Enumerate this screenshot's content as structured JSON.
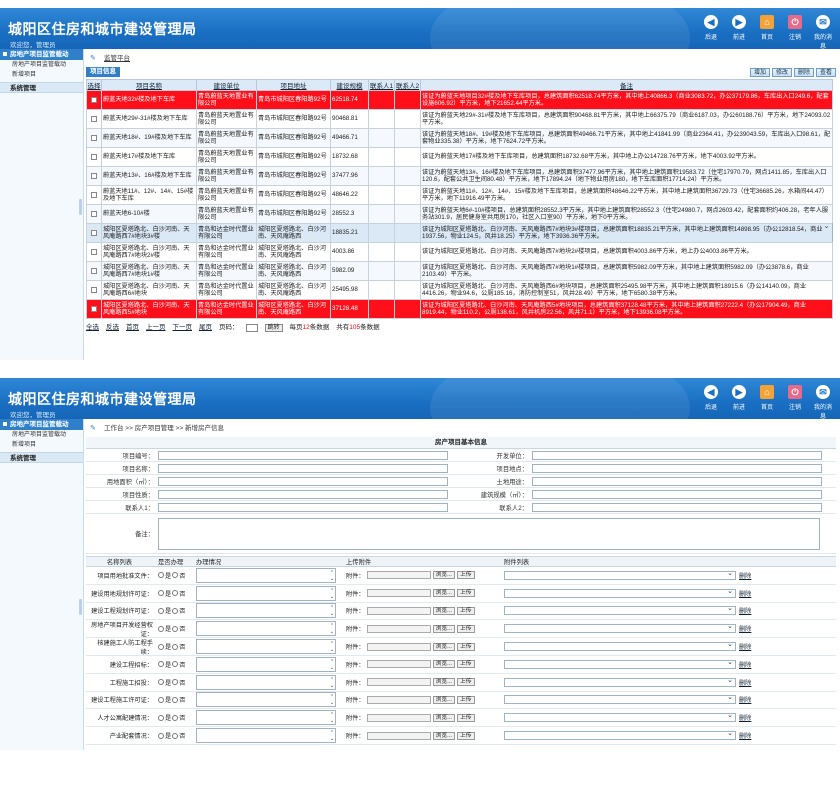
{
  "header": {
    "title": "城阳区住房和城市建设管理局",
    "welcome": "欢迎您，管理员",
    "nav": [
      {
        "label": "后退",
        "icon": "back-icon",
        "glyph": "◀"
      },
      {
        "label": "前进",
        "icon": "forward-icon",
        "glyph": "▶"
      },
      {
        "label": "首页",
        "icon": "home-icon",
        "glyph": "⌂"
      },
      {
        "label": "注销",
        "icon": "logout-icon",
        "glyph": "⏻"
      },
      {
        "label": "我的消息",
        "icon": "message-icon",
        "glyph": "✉"
      }
    ]
  },
  "sidebar": {
    "group_title": "房地产项目监管载动",
    "items": [
      "房地产项目监管载动",
      "新增项目"
    ],
    "section": "系统管理"
  },
  "list_view": {
    "breadcrumb": "监管平台",
    "tab_label": "项目信息",
    "toolbar": [
      "增加",
      "修改",
      "删除",
      "查看"
    ],
    "columns": [
      "选择",
      "项目名称",
      "建设单位",
      "项目地址",
      "建设规模",
      "联系人1",
      "联系人2",
      "备注"
    ],
    "rows": [
      {
        "name": "蔚蓝天地32#楼及地下车库",
        "unit": "青岛蔚蓝天地置业有限公司",
        "addr": "青岛市城阳区春阳路92号",
        "scale": "62518.74",
        "remark": "该证为蔚蓝天地项目32#楼及地下车库项目，总建筑面积62518.74平方米，其中地上40866.3（商业3083.72，办公37179.86，车库出入口249.6，配套设施606.92）平方米，地下21652.44平方米。",
        "style": "red"
      },
      {
        "name": "蔚蓝天地29#-31#楼及地下车库",
        "unit": "青岛蔚蓝天地置业有限公司",
        "addr": "青岛市城阳区春阳路92号",
        "scale": "90468.81",
        "remark": "该证为蔚蓝天地29#-31#楼及地下车库项目，总建筑面积90468.81平方米，其中地上66375.79（商业6187.03，办公60188.76）平方米，地下24093.02平方米。",
        "style": ""
      },
      {
        "name": "蔚蓝天地18#、19#楼及地下车库",
        "unit": "青岛蔚蓝天地置业有限公司",
        "addr": "青岛市城阳区春阳路92号",
        "scale": "49466.71",
        "remark": "该证为蔚蓝天地18#、19#楼及地下车库项目，总建筑面积49466.71平方米，其中地上41841.99（商业2364.41，办公39043.59，车库出入口98.61，配套物业335.38）平方米，地下7624.72平方米。",
        "style": "alt"
      },
      {
        "name": "蔚蓝天地17#楼及地下车库",
        "unit": "青岛蔚蓝天地置业有限公司",
        "addr": "青岛市城阳区春阳路92号",
        "scale": "18732.68",
        "remark": "该证为蔚蓝天地17#楼及地下车库项目，总建筑面积18732.68平方米，其中地上办公14728.76平方米，地下4003.92平方米。",
        "style": ""
      },
      {
        "name": "蔚蓝天地13#、16#楼及地下车库",
        "unit": "青岛蔚蓝天地置业有限公司",
        "addr": "青岛市城阳区春阳路92号",
        "scale": "37477.96",
        "remark": "该证为蔚蓝天地13#、16#楼及地下车库项目，总建筑面积37477.96平方米，其中地上建筑面积19583.72（住宅17970.79，网点1411.85，车库出入口120.6，配套公共卫生间80.48）平方米，地下17894.24（地下物业用房180，地下车库面积17714.24）平方米。",
        "style": "alt"
      },
      {
        "name": "蔚蓝天地11#、12#、14#、15#楼及地下车库",
        "unit": "青岛蔚蓝天地置业有限公司",
        "addr": "青岛市城阳区春阳路92号",
        "scale": "48646.22",
        "remark": "该证为蔚蓝天地11#、12#、14#、15#楼及地下车库项目，总建筑面积48646.22平方米，其中地上建筑面积36729.73（住宅36685.26，水箱间44.47）平方米，地下11916.49平方米。",
        "style": ""
      },
      {
        "name": "蔚蓝天地6-10#楼",
        "unit": "青岛蔚蓝天地置业有限公司",
        "addr": "青岛市城阳区春阳路92号",
        "scale": "28552.3",
        "remark": "该证为蔚蓝天地6#-10#楼项目，总建筑面积28552.3平方米，其中地上建筑面积28552.3（住宅24980.7，网点2603.42，配套面积约406.28，老年人服务站301.9，居民健身室共用房170，社区入口室90）平方米，地下0平方米。",
        "style": "alt"
      },
      {
        "name": "城阳区夏塔路北、白沙河南、天风庵路西7#地块3#楼",
        "unit": "青岛和达金时代置业有限公司",
        "addr": "城阳区夏塔路北、白沙河南、天风庵路西",
        "scale": "18835.21",
        "remark": "该证为城阳区夏塔路北、白沙河南、天风庵路西7#地块3#楼项目，总建筑面积18835.21平方米，其中地上建筑面积14898.95（办公12818.54，商业1937.56，物业124.5，风井18.25）平方米，地下3936.36平方米。",
        "style": "sel"
      },
      {
        "name": "城阳区夏塔路北、白沙河南、天风庵路西7#地块2#楼",
        "unit": "青岛和达金时代置业有限公司",
        "addr": "城阳区夏塔路北、白沙河南、天风庵路西",
        "scale": "4003.86",
        "remark": "该证为城阳区夏塔路北、白沙河南、天风庵路西7#地块2#楼项目，总建筑面积4003.86平方米，地上办公4003.86平方米。",
        "style": ""
      },
      {
        "name": "城阳区夏塔路北、白沙河南、天风庵路西7#地块1#楼",
        "unit": "青岛和达金时代置业有限公司",
        "addr": "城阳区夏塔路北、白沙河南、天风庵路西",
        "scale": "5982.09",
        "remark": "该证为城阳区夏塔路北、白沙河南、天风庵路西7#地块1#楼项目，总建筑面积5982.09平方米，其中地上建筑面积5982.09（办公3878.6，商业2103.49）平方米。",
        "style": "alt"
      },
      {
        "name": "城阳区夏塔路北、白沙河南、天风庵路西6#地块",
        "unit": "青岛和达金时代置业有限公司",
        "addr": "城阳区夏塔路北、白沙河南、天风庵路西",
        "scale": "25495.98",
        "remark": "该证为城阳区夏塔路北、白沙河南、天风庵路西6#地块项目，总建筑面积25495.98平方米，其中地上建筑面积18915.6（办公14140.09，商业4416.26，物业94.6，公厕185.16，消防控制室51，风井28.49）平方米，地下6580.38平方米。",
        "style": ""
      },
      {
        "name": "城阳区夏塔路北、白沙河南、天风庵路西5#地块",
        "unit": "青岛和达金时代置业有限公司",
        "addr": "城阳区夏塔路北、白沙河南、天风庵路西",
        "scale": "37128.48",
        "remark": "该证为城阳区夏塔路北、白沙河南、天风庵路西5#地块项目，总建筑面积37128.48平方米，其中地上建筑面积27222.4（办公17904.49，商业8919.44，物业110.2，公厕138.61，风井机房22.56，风井71.1）平方米，地下13936.08平方米。",
        "style": "red"
      }
    ],
    "pager": {
      "items": [
        "全选",
        "反选",
        "首页",
        "上一页",
        "下一页",
        "尾页"
      ],
      "page_label": "页码：",
      "go": "跳转",
      "per_page_pre": "每页",
      "per_page": "12",
      "per_page_post": "条数据",
      "total_pre": "共有",
      "total": "105",
      "total_post": "条数据"
    }
  },
  "form_view": {
    "breadcrumb": [
      "工作台",
      "房产项目管理",
      "新增房产信息"
    ],
    "breadcrumb_sep": " >> ",
    "form_title": "房产项目基本信息",
    "fields_left": [
      "项目编号：",
      "项目名称：",
      "用地面积（㎡）：",
      "项目性质：",
      "联系人1："
    ],
    "fields_right": [
      "开发单位：",
      "项目地点：",
      "土地用途：",
      "建筑规模（㎡）：",
      "联系人2："
    ],
    "remark_label": "备注：",
    "doc_headers": [
      "名称列表",
      "是否办理",
      "办理情况",
      "上传附件",
      "附件列表"
    ],
    "yes": "是",
    "no": "否",
    "attach_label": "附件：",
    "browse": "浏览...",
    "upload": "上传",
    "delete": "删除",
    "docs": [
      "项目用地批准文件：",
      "建设用地规划许可证：",
      "建设工程规划许可证：",
      "房地产项目开发经营权证：",
      "核建施工人防工程手续：",
      "建设工程招标：",
      "工程施工招投：",
      "建设工程施工许可证：",
      "人才公寓配建情况：",
      "产业配套情况："
    ]
  }
}
